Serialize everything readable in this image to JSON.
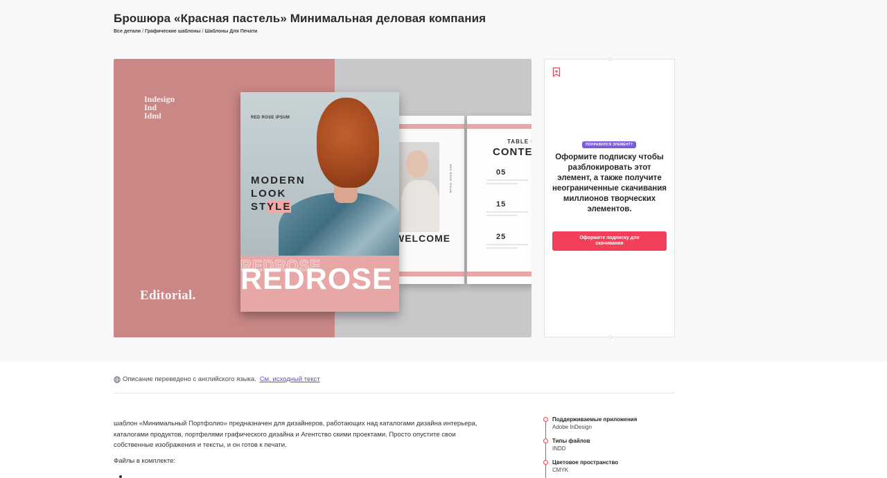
{
  "page": {
    "title": "Брошюра «Красная пастель» Минимальная деловая компания",
    "breadcrumb": [
      "Все детали",
      "Графические шаблоны",
      "Шаблоны Для Печати"
    ]
  },
  "preview": {
    "formats": [
      "Indesign",
      "Ind",
      "Idml"
    ],
    "editorial_text": "Editorial.",
    "cover": {
      "brand": "RED ROSE IPSUM",
      "headline_1": "MODERN",
      "headline_2": "LOOK",
      "headline_3a": "ST",
      "headline_3b": "YLE",
      "band_text": "REDROSE"
    },
    "spread": {
      "welcome": "WELCOME",
      "toc_top": "TABLE OF",
      "toc_title": "CONTENTS",
      "vertical": "RED ROSE IPSUM",
      "numbers": [
        "05",
        "15",
        "25"
      ]
    },
    "colors": {
      "left_bg": "#c98786",
      "right_bg": "#c8c8ca",
      "accent_pink": "#e7a7a6"
    }
  },
  "side_card": {
    "bookmark_icon": "bookmark-plus-icon",
    "badge": "ПОНРАВИЛСЯ ЭЛЕМЕНТ?",
    "promo_text": "Оформите подписку чтобы разблокировать этот элемент, а также получите неограниченные скачивания миллионов творческих элементов.",
    "button_label": "Оформите подписку для скачивания",
    "button_color": "#f2405a",
    "badge_color": "#7b5cd6"
  },
  "notice": {
    "icon": "globe-icon",
    "text": "Описание переведено с английского языка.",
    "link": "См. исходный текст"
  },
  "description": {
    "text": "шаблон «Минимальный Портфолио» предназначен для дизайнеров, работающих над каталогами дизайна интерьера, каталогами продуктов, портфелями графического дизайна и Агентство скими проектами. Просто опустите свои собственные изображения и тексты, и он готов к печати.",
    "files_label": "Файлы в комплекте:"
  },
  "specs": [
    {
      "key": "Поддерживаемые приложения",
      "value": "Adobe InDesign"
    },
    {
      "key": "Типы файлов",
      "value": "INDD"
    },
    {
      "key": "Цветовое пространство",
      "value": "CMYK"
    }
  ]
}
